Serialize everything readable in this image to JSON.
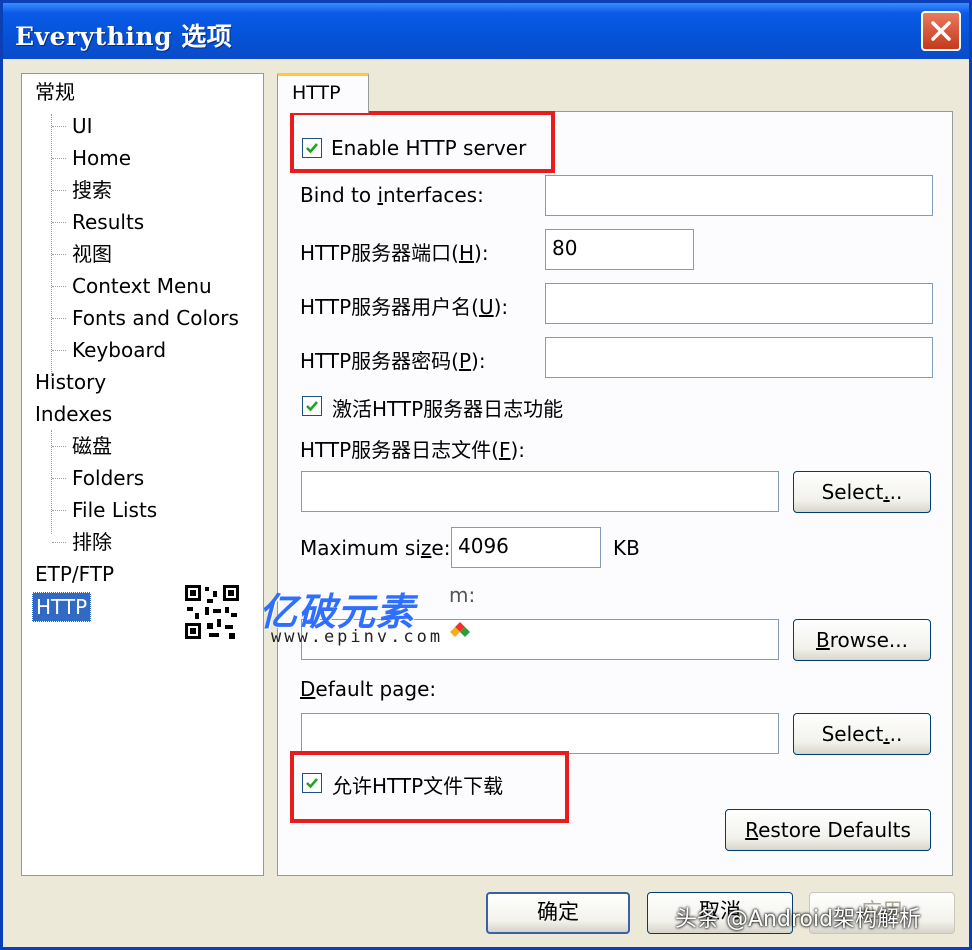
{
  "window": {
    "title": "Everything 选项"
  },
  "tree": {
    "items": [
      "常规",
      "UI",
      "Home",
      "搜索",
      "Results",
      "视图",
      "Context Menu",
      "Fonts and Colors",
      "Keyboard",
      "History",
      "Indexes",
      "磁盘",
      "Folders",
      "File Lists",
      "排除",
      "ETP/FTP",
      "HTTP"
    ],
    "selected": "HTTP"
  },
  "tab": {
    "label": "HTTP"
  },
  "http": {
    "enable_server": {
      "label": "Enable HTTP server",
      "checked": true
    },
    "bind_interfaces": {
      "label_pre": "Bind to ",
      "label_acc": "i",
      "label_post": "nterfaces:",
      "value": ""
    },
    "port": {
      "label_pre": "HTTP服务器端口(",
      "label_acc": "H",
      "label_post": "):",
      "value": "80"
    },
    "username": {
      "label_pre": "HTTP服务器用户名(",
      "label_acc": "U",
      "label_post": "):",
      "value": ""
    },
    "password": {
      "label_pre": "HTTP服务器密码(",
      "label_acc": "P",
      "label_post": "):",
      "value": ""
    },
    "enable_log": {
      "label": "激活HTTP服务器日志功能",
      "checked": true
    },
    "log_file": {
      "label_pre": "HTTP服务器日志文件(",
      "label_acc": "F",
      "label_post": "):",
      "value": "",
      "button_pre": "Select",
      "button_acc": ".",
      "button_post": ".."
    },
    "max_size": {
      "label_pre": "Maximum si",
      "label_acc": "z",
      "label_post": "e:",
      "value": "4096",
      "unit": "KB"
    },
    "home": {
      "label_partial": "m:",
      "value": "",
      "button_pre": "",
      "button_acc": "B",
      "button_post": "rowse..."
    },
    "default_page": {
      "label_pre": "",
      "label_acc": "D",
      "label_post": "efault page:",
      "value": "",
      "button_pre": "Select",
      "button_acc": ".",
      "button_post": ".."
    },
    "allow_download": {
      "label": "允许HTTP文件下载",
      "checked": true
    },
    "restore_defaults": {
      "label_pre": "",
      "label_acc": "R",
      "label_post": "estore Defaults"
    }
  },
  "footer": {
    "ok": "确定",
    "cancel": "取消",
    "apply": "应用"
  },
  "watermark": {
    "logo": "亿破元素",
    "url": "www.epinv.com",
    "corner": "头条 @Android架构解析"
  },
  "colors": {
    "highlight": "#e81c1c",
    "titlebar": "#0553d8",
    "selection": "#316ac5"
  }
}
